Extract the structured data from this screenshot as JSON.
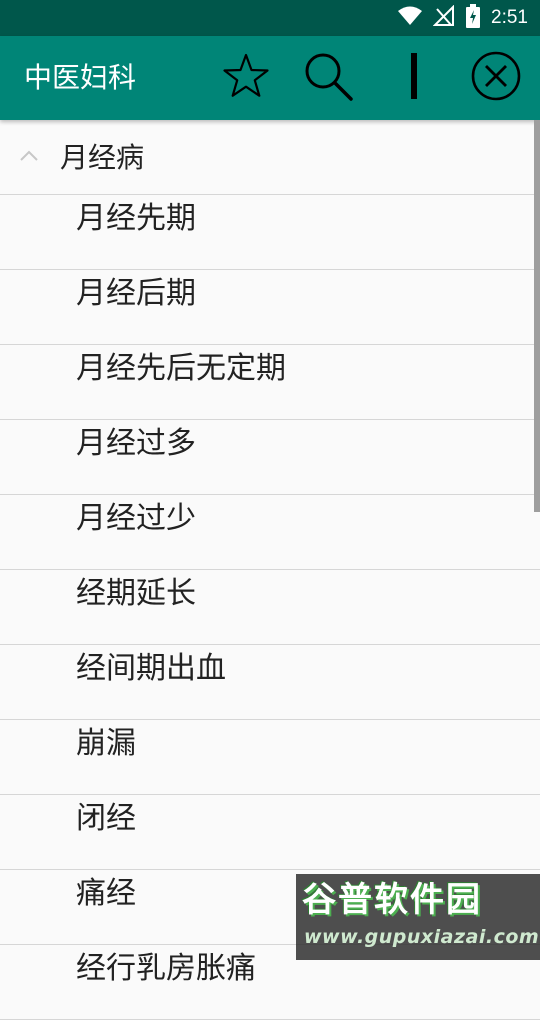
{
  "status_bar": {
    "time": "2:51"
  },
  "toolbar": {
    "title": "中医妇科",
    "actions": [
      "star-icon",
      "search-icon",
      "text-cursor-icon",
      "close-circle-icon"
    ]
  },
  "list": {
    "group": {
      "label": "月经病",
      "expanded": true
    },
    "items": [
      {
        "label": "月经先期"
      },
      {
        "label": "月经后期"
      },
      {
        "label": "月经先后无定期"
      },
      {
        "label": "月经过多"
      },
      {
        "label": "月经过少"
      },
      {
        "label": "经期延长"
      },
      {
        "label": "经间期出血"
      },
      {
        "label": "崩漏"
      },
      {
        "label": "闭经"
      },
      {
        "label": "痛经"
      },
      {
        "label": "经行乳房胀痛"
      }
    ]
  },
  "watermark": {
    "title": "谷普软件园",
    "url": "www.gupuxiazai.com"
  },
  "colors": {
    "status_bar": "#00574b",
    "toolbar": "#008577",
    "background": "#fafafa"
  }
}
